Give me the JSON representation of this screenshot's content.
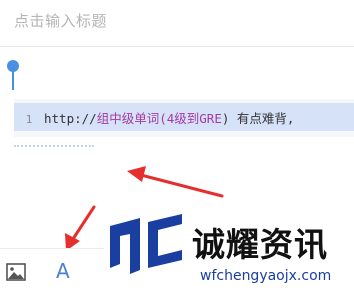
{
  "title": {
    "placeholder": "点击输入标题"
  },
  "code_block": {
    "line_number": "1",
    "tokens": {
      "t1": "http://",
      "t2": "组中级单词",
      "t3": "(4级到",
      "t4": "GRE",
      "t5": ") 有点难背,"
    }
  },
  "toolbar": {
    "image_icon": "image-icon",
    "font_label": "A"
  },
  "watermark": {
    "text": "诚耀资讯",
    "url": "wfchengyaojx.com"
  },
  "colors": {
    "accent": "#4a90e2",
    "highlight": "#d5e2f7",
    "keyword": "#a33aa1",
    "arrow": "#e52f2f",
    "watermark_blue": "#1a3fa0"
  }
}
